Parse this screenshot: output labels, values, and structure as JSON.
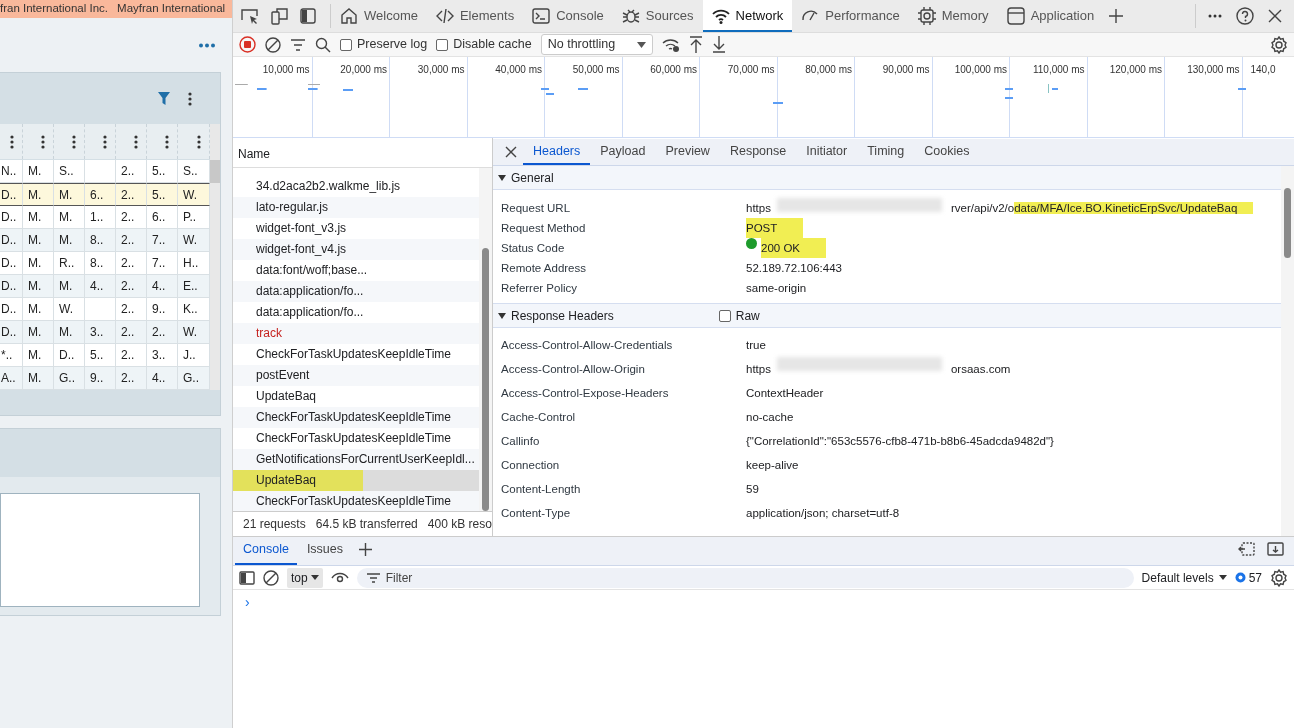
{
  "app": {
    "banner": [
      "fran International Inc.",
      "Mayfran International"
    ],
    "grid": {
      "rows": [
        {
          "cells": [
            "N..",
            "M.",
            "S..",
            null,
            "2..",
            "5..",
            "S.."
          ],
          "selected": false
        },
        {
          "cells": [
            "D..",
            "M.",
            "M.",
            "6..",
            "2..",
            "5..",
            "W."
          ],
          "selected": true
        },
        {
          "cells": [
            "D..",
            "M.",
            "M.",
            "1..",
            "2..",
            "6..",
            "P.."
          ],
          "selected": false
        },
        {
          "cells": [
            "D..",
            "M.",
            "M.",
            "8..",
            "2..",
            "7..",
            "W."
          ],
          "selected": false
        },
        {
          "cells": [
            "D..",
            "M.",
            "R..",
            "8..",
            "2..",
            "7..",
            "H.."
          ],
          "selected": false
        },
        {
          "cells": [
            "D..",
            "M.",
            "M.",
            "4..",
            "2..",
            "4..",
            "E.."
          ],
          "selected": false
        },
        {
          "cells": [
            "D..",
            "M.",
            "W.",
            null,
            "2..",
            "9..",
            "K.."
          ],
          "selected": false
        },
        {
          "cells": [
            "D..",
            "M.",
            "M.",
            "3..",
            "2..",
            "2..",
            "W."
          ],
          "selected": false
        },
        {
          "cells": [
            "*..",
            "M.",
            "D..",
            "5..",
            "2..",
            "3..",
            "J.."
          ],
          "selected": false
        },
        {
          "cells": [
            "A..",
            "M.",
            "G..",
            "9..",
            "2..",
            "4..",
            "G.."
          ],
          "selected": false
        }
      ]
    }
  },
  "devtools": {
    "tabs": [
      {
        "label": "Welcome",
        "selected": false
      },
      {
        "label": "Elements",
        "selected": false
      },
      {
        "label": "Console",
        "selected": false
      },
      {
        "label": "Sources",
        "selected": false
      },
      {
        "label": "Network",
        "selected": true
      },
      {
        "label": "Performance",
        "selected": false
      },
      {
        "label": "Memory",
        "selected": false
      },
      {
        "label": "Application",
        "selected": false
      }
    ],
    "network_toolbar": {
      "recording": true,
      "preserve_log": {
        "label": "Preserve log",
        "checked": false
      },
      "disable_cache": {
        "label": "Disable cache",
        "checked": false
      },
      "throttling": "No throttling"
    },
    "overview": {
      "ticks": [
        "10,000 ms",
        "20,000 ms",
        "30,000 ms",
        "40,000 ms",
        "50,000 ms",
        "60,000 ms",
        "70,000 ms",
        "80,000 ms",
        "90,000 ms",
        "100,000 ms",
        "110,000 ms",
        "120,000 ms",
        "130,000 ms",
        "140,0"
      ]
    },
    "requests": {
      "column": "Name",
      "rows": [
        {
          "name": "34.d2aca2b2.walkme_lib.js",
          "failed": false,
          "selected": false,
          "highlighted": false
        },
        {
          "name": "lato-regular.js",
          "failed": false,
          "selected": false,
          "highlighted": false
        },
        {
          "name": "widget-font_v3.js",
          "failed": false,
          "selected": false,
          "highlighted": false
        },
        {
          "name": "widget-font_v4.js",
          "failed": false,
          "selected": false,
          "highlighted": false
        },
        {
          "name": "data:font/woff;base...",
          "failed": false,
          "selected": false,
          "highlighted": false
        },
        {
          "name": "data:application/fo...",
          "failed": false,
          "selected": false,
          "highlighted": false
        },
        {
          "name": "data:application/fo...",
          "failed": false,
          "selected": false,
          "highlighted": false
        },
        {
          "name": "track",
          "failed": true,
          "selected": false,
          "highlighted": false
        },
        {
          "name": "CheckForTaskUpdatesKeepIdleTime",
          "failed": false,
          "selected": false,
          "highlighted": false
        },
        {
          "name": "postEvent",
          "failed": false,
          "selected": false,
          "highlighted": false
        },
        {
          "name": "UpdateBaq",
          "failed": false,
          "selected": false,
          "highlighted": false
        },
        {
          "name": "CheckForTaskUpdatesKeepIdleTime",
          "failed": false,
          "selected": false,
          "highlighted": false
        },
        {
          "name": "CheckForTaskUpdatesKeepIdleTime",
          "failed": false,
          "selected": false,
          "highlighted": false
        },
        {
          "name": "GetNotificationsForCurrentUserKeepIdl...",
          "failed": false,
          "selected": false,
          "highlighted": false
        },
        {
          "name": "UpdateBaq",
          "failed": false,
          "selected": true,
          "highlighted": true
        },
        {
          "name": "CheckForTaskUpdatesKeepIdleTime",
          "failed": false,
          "selected": false,
          "highlighted": false
        }
      ],
      "summary": [
        "21 requests",
        "64.5 kB transferred",
        "400 kB reso"
      ]
    },
    "details": {
      "tabs": [
        {
          "label": "Headers",
          "selected": true
        },
        {
          "label": "Payload",
          "selected": false
        },
        {
          "label": "Preview",
          "selected": false
        },
        {
          "label": "Response",
          "selected": false
        },
        {
          "label": "Initiator",
          "selected": false
        },
        {
          "label": "Timing",
          "selected": false
        },
        {
          "label": "Cookies",
          "selected": false
        }
      ],
      "general": {
        "title": "General",
        "expanded": true,
        "rows": [
          {
            "name": "Request URL",
            "value": "https",
            "redacted": true,
            "value_end": "rver/api/v2/o",
            "value_highlighted": "data/MFA/Ice.BO.KineticErpSvc/UpdateBaq"
          },
          {
            "name": "Request Method",
            "value": "POST",
            "highlighted": true
          },
          {
            "name": "Status Code",
            "value": "200 OK",
            "highlighted": true,
            "status_ok": true
          },
          {
            "name": "Remote Address",
            "value": "52.189.72.106:443"
          },
          {
            "name": "Referrer Policy",
            "value": "same-origin"
          }
        ]
      },
      "response_headers": {
        "title": "Response Headers",
        "expanded": true,
        "raw": {
          "label": "Raw",
          "checked": false
        },
        "rows": [
          {
            "name": "Access-Control-Allow-Credentials",
            "value": "true"
          },
          {
            "name": "Access-Control-Allow-Origin",
            "value": "https",
            "redacted": true,
            "value_end": "orsaas.com"
          },
          {
            "name": "Access-Control-Expose-Headers",
            "value": "ContextHeader"
          },
          {
            "name": "Cache-Control",
            "value": "no-cache"
          },
          {
            "name": "Callinfo",
            "value": "{\"CorrelationId\":\"653c5576-cfb8-471b-b8b6-45adcda9482d\"}"
          },
          {
            "name": "Connection",
            "value": "keep-alive"
          },
          {
            "name": "Content-Length",
            "value": "59"
          },
          {
            "name": "Content-Type",
            "value": "application/json; charset=utf-8"
          }
        ]
      }
    },
    "drawer": {
      "tabs": [
        {
          "label": "Console",
          "selected": true
        },
        {
          "label": "Issues",
          "selected": false
        }
      ],
      "context": "top",
      "filter": {
        "placeholder": "Filter"
      },
      "levels": "Default levels",
      "message_count": "57",
      "prompt": "›"
    }
  }
}
